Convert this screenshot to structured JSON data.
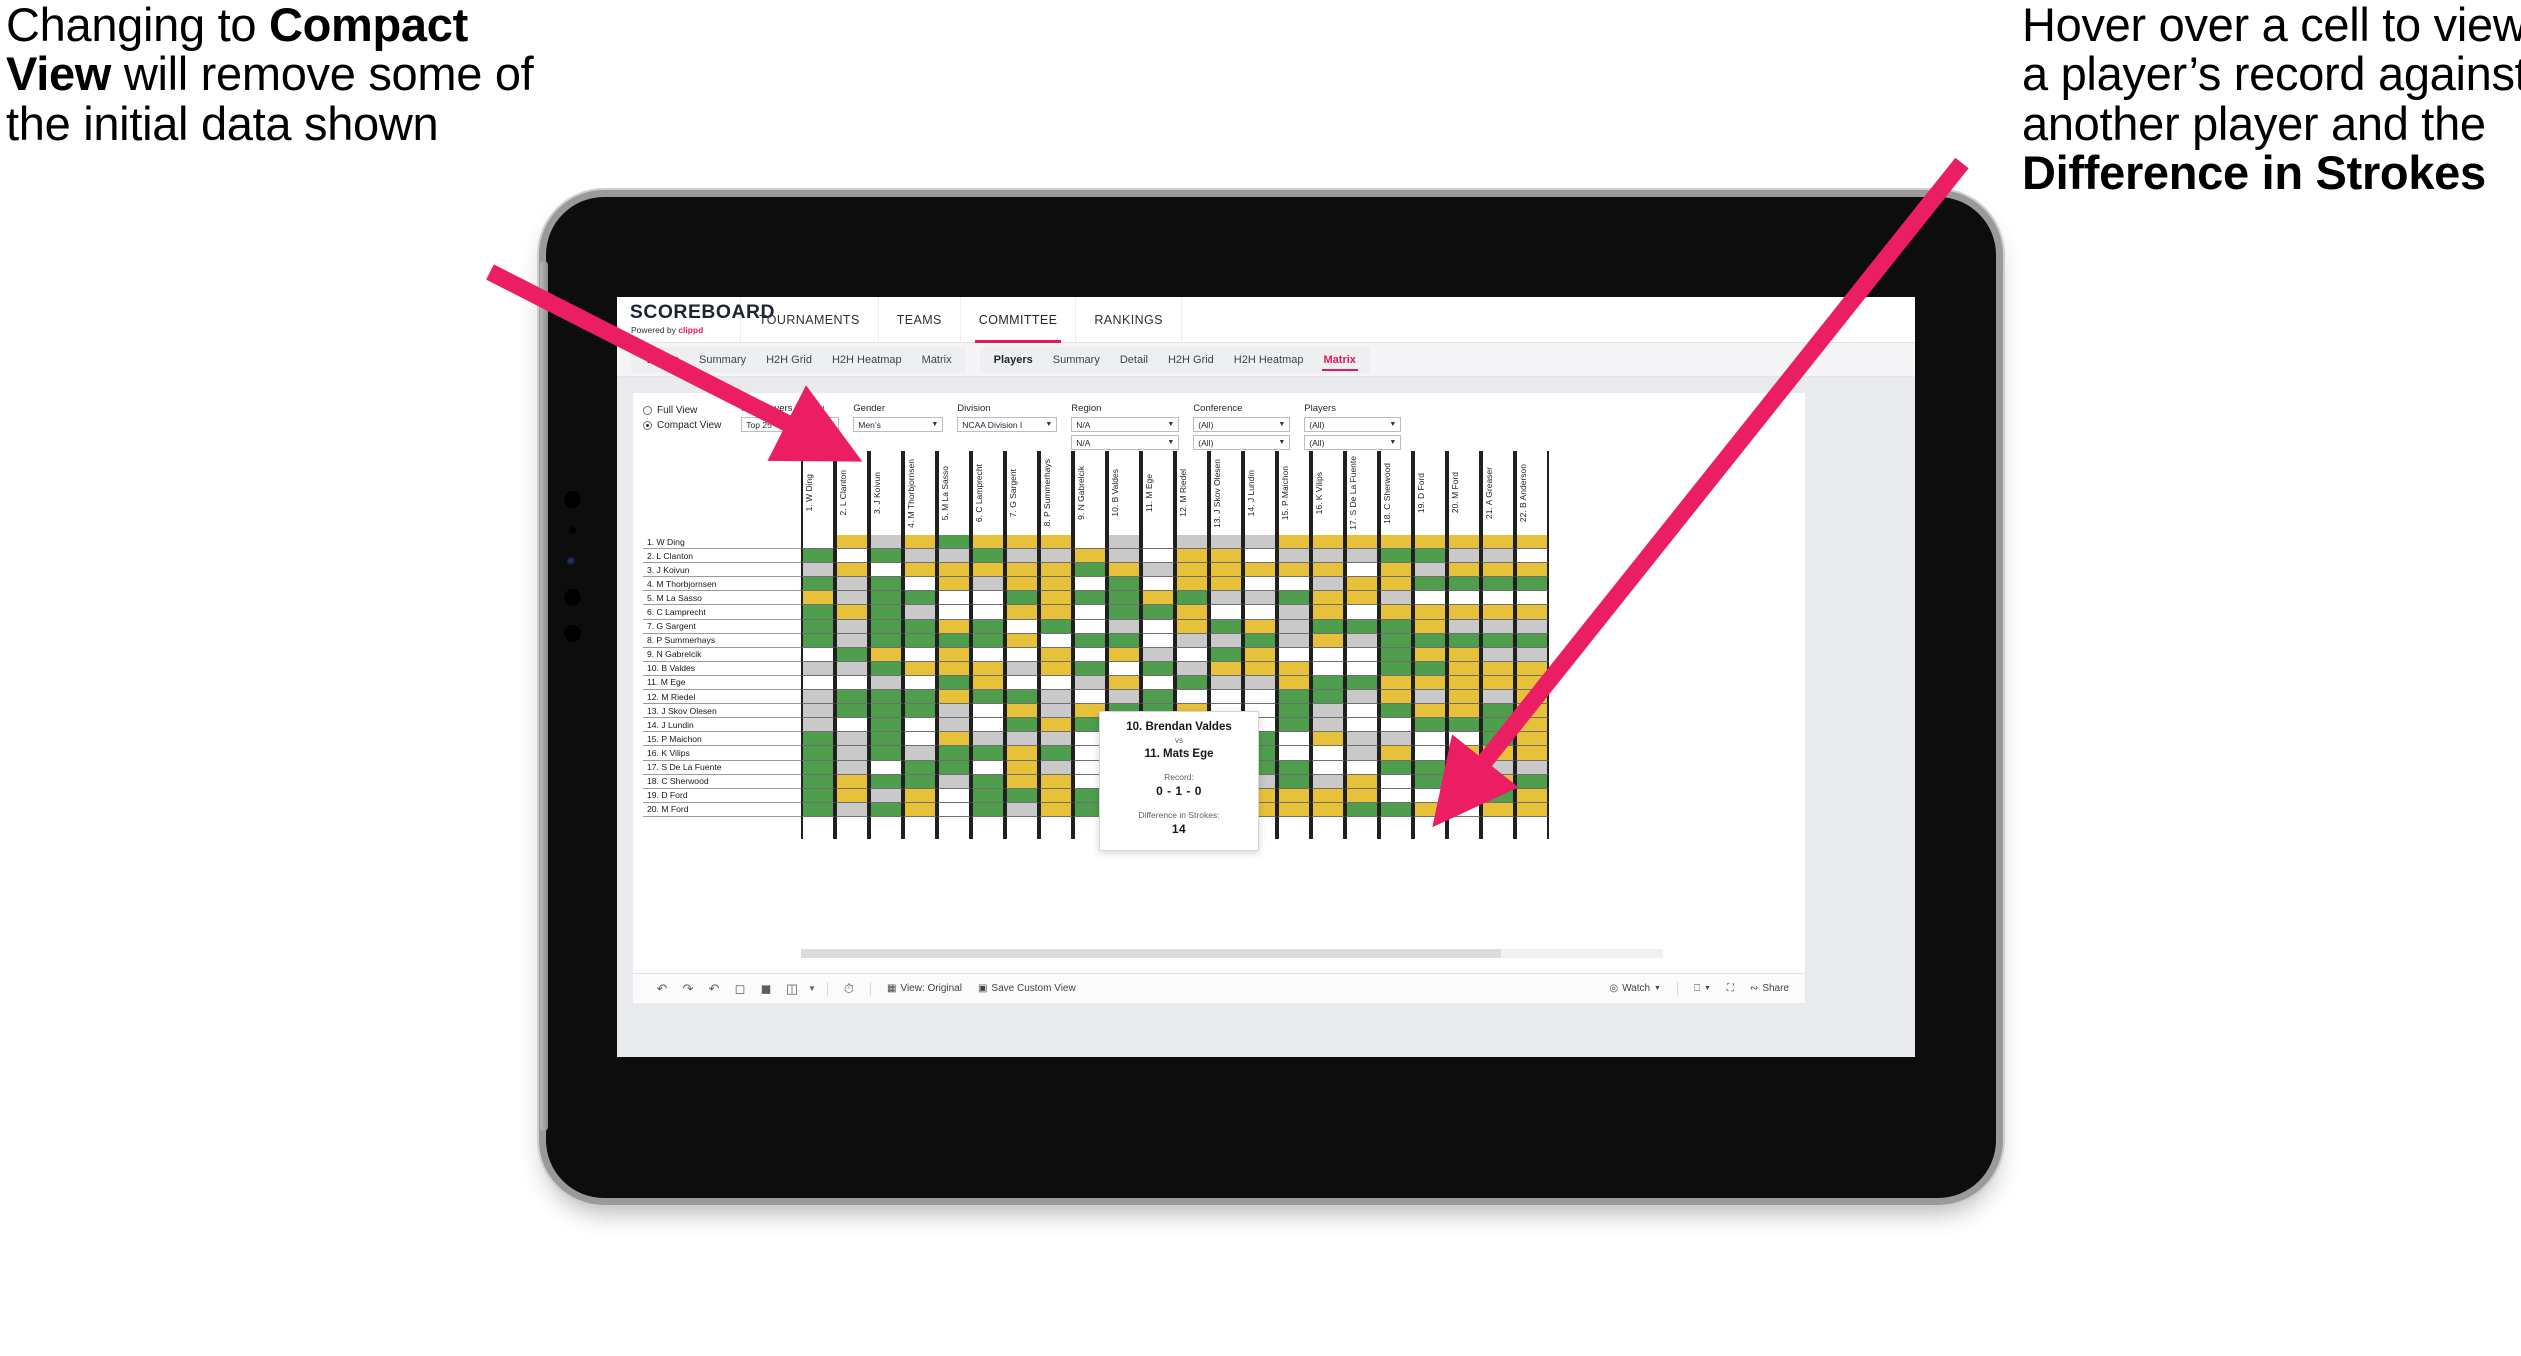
{
  "annotations": {
    "left": {
      "line1": "Changing to ",
      "bold1": "Compact View",
      "line2": " will remove some of the initial data shown"
    },
    "right": {
      "line1": "Hover over a cell to view a player’s record against another player and the ",
      "bold1": "Difference in Strokes"
    }
  },
  "app": {
    "logo": {
      "word": "SCOREBOARD",
      "powered": "Powered by ",
      "brand": "clippd"
    },
    "topnav": [
      {
        "label": "TOURNAMENTS",
        "active": false
      },
      {
        "label": "TEAMS",
        "active": false
      },
      {
        "label": "COMMITTEE",
        "active": true
      },
      {
        "label": "RANKINGS",
        "active": false
      }
    ],
    "subnav": {
      "group1": [
        {
          "label": "Teams",
          "head": true
        },
        {
          "label": "Summary"
        },
        {
          "label": "H2H Grid"
        },
        {
          "label": "H2H Heatmap"
        },
        {
          "label": "Matrix"
        }
      ],
      "group2": [
        {
          "label": "Players",
          "head": true
        },
        {
          "label": "Summary"
        },
        {
          "label": "Detail"
        },
        {
          "label": "H2H Grid"
        },
        {
          "label": "H2H Heatmap"
        },
        {
          "label": "Matrix",
          "active": true
        }
      ]
    }
  },
  "filters": {
    "view_modes": [
      {
        "label": "Full View",
        "selected": false
      },
      {
        "label": "Compact View",
        "selected": true
      }
    ],
    "fields": [
      {
        "label": "Max players in view",
        "values": [
          "Top 25"
        ],
        "width": "w-top25"
      },
      {
        "label": "Gender",
        "values": [
          "Men’s"
        ],
        "width": "w-gender"
      },
      {
        "label": "Division",
        "values": [
          "NCAA Division I"
        ],
        "width": "w-div"
      },
      {
        "label": "Region",
        "values": [
          "N/A",
          "N/A"
        ],
        "width": "w-region"
      },
      {
        "label": "Conference",
        "values": [
          "(All)",
          "(All)"
        ],
        "width": "w-conf"
      },
      {
        "label": "Players",
        "values": [
          "(All)",
          "(All)"
        ],
        "width": "w-players"
      }
    ]
  },
  "matrix": {
    "columns": [
      "1. W Ding",
      "2. L Clanton",
      "3. J Koivun",
      "4. M Thorbjornsen",
      "5. M La Sasso",
      "6. C Lamprecht",
      "7. G Sargent",
      "8. P Summerhays",
      "9. N Gabrelcik",
      "10. B Valdes",
      "11. M Ege",
      "12. M Riedel",
      "13. J Skov Olesen",
      "14. J Lundin",
      "15. P Maichon",
      "16. K Vilips",
      "17. S De La Fuente",
      "18. C Sherwood",
      "19. D Ford",
      "20. M Ford",
      "21. A Greaser",
      "22. B Anderson"
    ],
    "rows": [
      "1. W Ding",
      "2. L Clanton",
      "3. J Koivun",
      "4. M Thorbjornsen",
      "5. M La Sasso",
      "6. C Lamprecht",
      "7. G Sargent",
      "8. P Summerhays",
      "9. N Gabrelcik",
      "10. B Valdes",
      "11. M Ege",
      "12. M Riedel",
      "13. J Skov Olesen",
      "14. J Lundin",
      "15. P Maichon",
      "16. K Vilips",
      "17. S De La Fuente",
      "18. C Sherwood",
      "19. D Ford",
      "20. M Ford"
    ],
    "legend": {
      "win": "#4e9e4e",
      "loss": "#e8c13b",
      "tie": "#c9c9c9",
      "none": "#ffffff"
    },
    "cells": [
      [
        "w",
        "y",
        "a",
        "y",
        "g",
        "y",
        "y",
        "y",
        "w",
        "a",
        "w",
        "a",
        "a",
        "a",
        "y",
        "y",
        "y",
        "y",
        "y",
        "y",
        "y",
        "y"
      ],
      [
        "g",
        "w",
        "g",
        "a",
        "a",
        "g",
        "a",
        "a",
        "y",
        "a",
        "w",
        "y",
        "y",
        "w",
        "a",
        "a",
        "a",
        "g",
        "g",
        "a",
        "a",
        "w"
      ],
      [
        "a",
        "y",
        "w",
        "y",
        "y",
        "y",
        "y",
        "y",
        "g",
        "y",
        "a",
        "y",
        "y",
        "y",
        "y",
        "y",
        "w",
        "y",
        "a",
        "y",
        "y",
        "y"
      ],
      [
        "g",
        "a",
        "g",
        "w",
        "y",
        "a",
        "y",
        "y",
        "w",
        "g",
        "w",
        "y",
        "y",
        "w",
        "w",
        "a",
        "y",
        "y",
        "g",
        "g",
        "g",
        "g"
      ],
      [
        "y",
        "a",
        "g",
        "g",
        "w",
        "w",
        "g",
        "y",
        "g",
        "g",
        "y",
        "g",
        "a",
        "a",
        "g",
        "y",
        "y",
        "a",
        "w",
        "w",
        "w",
        "w"
      ],
      [
        "g",
        "y",
        "g",
        "a",
        "w",
        "w",
        "y",
        "y",
        "w",
        "g",
        "g",
        "y",
        "w",
        "w",
        "a",
        "y",
        "w",
        "y",
        "y",
        "y",
        "y",
        "y"
      ],
      [
        "g",
        "a",
        "g",
        "g",
        "y",
        "g",
        "w",
        "g",
        "w",
        "a",
        "w",
        "y",
        "g",
        "y",
        "a",
        "g",
        "g",
        "g",
        "y",
        "a",
        "a",
        "a"
      ],
      [
        "g",
        "a",
        "g",
        "g",
        "g",
        "g",
        "y",
        "w",
        "g",
        "g",
        "w",
        "a",
        "a",
        "g",
        "a",
        "y",
        "a",
        "g",
        "g",
        "g",
        "g",
        "g"
      ],
      [
        "w",
        "g",
        "y",
        "w",
        "y",
        "w",
        "w",
        "y",
        "w",
        "y",
        "a",
        "w",
        "g",
        "y",
        "w",
        "w",
        "w",
        "g",
        "y",
        "y",
        "a",
        "a"
      ],
      [
        "a",
        "a",
        "g",
        "y",
        "y",
        "y",
        "a",
        "y",
        "g",
        "w",
        "g",
        "a",
        "y",
        "y",
        "y",
        "w",
        "w",
        "g",
        "g",
        "y",
        "y",
        "y"
      ],
      [
        "w",
        "w",
        "a",
        "w",
        "g",
        "y",
        "w",
        "w",
        "a",
        "y",
        "w",
        "g",
        "a",
        "a",
        "y",
        "g",
        "g",
        "y",
        "y",
        "y",
        "y",
        "y"
      ],
      [
        "a",
        "g",
        "g",
        "g",
        "y",
        "g",
        "g",
        "a",
        "w",
        "a",
        "g",
        "w",
        "w",
        "w",
        "g",
        "g",
        "a",
        "y",
        "a",
        "y",
        "a",
        "y"
      ],
      [
        "a",
        "g",
        "g",
        "g",
        "a",
        "w",
        "y",
        "a",
        "y",
        "g",
        "g",
        "y",
        "w",
        "w",
        "g",
        "a",
        "w",
        "g",
        "y",
        "y",
        "g",
        "y"
      ],
      [
        "a",
        "w",
        "g",
        "w",
        "a",
        "w",
        "g",
        "y",
        "g",
        "g",
        "g",
        "a",
        "a",
        "w",
        "g",
        "a",
        "w",
        "w",
        "g",
        "g",
        "g",
        "y"
      ],
      [
        "g",
        "a",
        "g",
        "w",
        "y",
        "a",
        "a",
        "a",
        "w",
        "g",
        "g",
        "a",
        "a",
        "g",
        "w",
        "y",
        "a",
        "a",
        "w",
        "w",
        "g",
        "y"
      ],
      [
        "g",
        "a",
        "g",
        "a",
        "g",
        "g",
        "y",
        "g",
        "w",
        "g",
        "g",
        "a",
        "g",
        "g",
        "w",
        "w",
        "a",
        "y",
        "w",
        "y",
        "y",
        "y"
      ],
      [
        "g",
        "a",
        "w",
        "g",
        "g",
        "w",
        "y",
        "a",
        "w",
        "w",
        "g",
        "w",
        "y",
        "g",
        "g",
        "w",
        "w",
        "g",
        "g",
        "a",
        "a",
        "a"
      ],
      [
        "g",
        "y",
        "g",
        "g",
        "a",
        "g",
        "y",
        "y",
        "w",
        "y",
        "w",
        "g",
        "y",
        "a",
        "g",
        "a",
        "y",
        "w",
        "g",
        "y",
        "y",
        "g"
      ],
      [
        "g",
        "y",
        "a",
        "y",
        "w",
        "g",
        "g",
        "y",
        "g",
        "y",
        "w",
        "w",
        "g",
        "y",
        "y",
        "y",
        "y",
        "w",
        "w",
        "y",
        "g",
        "y"
      ],
      [
        "g",
        "a",
        "g",
        "y",
        "w",
        "g",
        "a",
        "y",
        "g",
        "g",
        "w",
        "w",
        "g",
        "y",
        "y",
        "y",
        "g",
        "g",
        "y",
        "w",
        "y",
        "y"
      ]
    ],
    "scroll": {
      "orientation": "horizontal"
    }
  },
  "tooltip": {
    "player_a": "10. Brendan Valdes",
    "vs": "vs",
    "player_b": "11. Mats Ege",
    "record_label": "Record:",
    "record_value": "0 - 1 - 0",
    "diff_label": "Difference in Strokes:",
    "diff_value": "14"
  },
  "bottombar": {
    "icons": [
      "undo-icon",
      "redo-icon",
      "revert-icon",
      "pause-icon",
      "refresh-icon",
      "flip-icon",
      "caret-icon",
      "clock-icon"
    ],
    "view_label": "View: Original",
    "save_label": "Save Custom View",
    "watch_label": "Watch",
    "download_label": "download-icon",
    "fullscreen_label": "fullscreen-icon",
    "share_label": "Share"
  },
  "colors": {
    "accent": "#e8175d",
    "arrow": "#ec1e63",
    "page_bg": "#e9eaee"
  }
}
